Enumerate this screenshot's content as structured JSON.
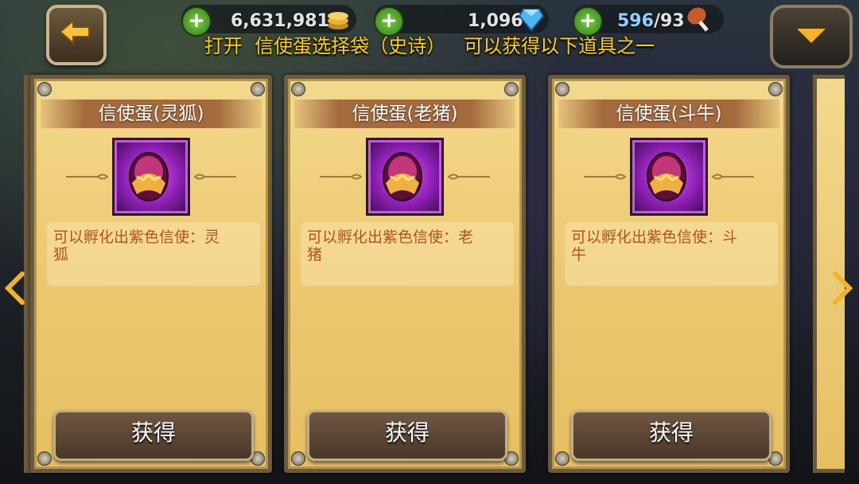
{
  "hud": {
    "gold": "6,631,981",
    "gems": "1,096",
    "stamina_current": "596",
    "stamina_max": "/93"
  },
  "title": "打开  信使蛋选择袋（史诗）   可以获得以下道具之一",
  "cards": [
    {
      "name": "信使蛋(灵狐)",
      "desc_line1": "可以孵化出紫色信使：灵",
      "desc_line2": "狐",
      "button": "获得"
    },
    {
      "name": "信使蛋(老猪)",
      "desc_line1": "可以孵化出紫色信使：老",
      "desc_line2": "猪",
      "button": "获得"
    },
    {
      "name": "信使蛋(斗牛)",
      "desc_line1": "可以孵化出紫色信使：斗",
      "desc_line2": "牛",
      "button": "获得"
    }
  ],
  "colors": {
    "title": "#ffd200",
    "desc_text": "#b0531f",
    "card_bg": "#ecc870",
    "egg_frame": "#8d1fb4"
  },
  "icons": [
    "back-arrow-icon",
    "plus-icon",
    "coin-icon",
    "gem-icon",
    "meat-icon",
    "menu-dropdown-icon",
    "egg-icon",
    "prev-arrow-icon",
    "next-arrow-icon"
  ]
}
